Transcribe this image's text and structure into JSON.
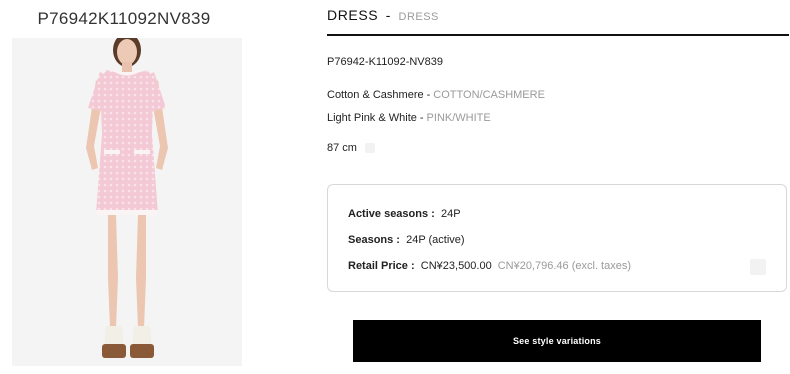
{
  "product": {
    "sku_heading": "P76942K11092NV839",
    "title": "DRESS",
    "title_sep": "-",
    "title_en": "DRESS",
    "reference": "P76942-K11092-NV839",
    "material": "Cotton & Cashmere",
    "material_en": "COTTON/CASHMERE",
    "color": "Light Pink & White",
    "color_en": "PINK/WHITE",
    "length": "87 cm"
  },
  "info": {
    "active_seasons_label": "Active seasons :",
    "active_seasons_value": "24P",
    "seasons_label": "Seasons :",
    "seasons_value": "24P (active)",
    "retail_price_label": "Retail Price :",
    "retail_price_value": "CN¥23,500.00",
    "retail_price_excl": "CN¥20,796.46 (excl. taxes)"
  },
  "actions": {
    "style_variations_label": "See style variations"
  },
  "colors": {
    "dress_pink": "#f3c9d5",
    "trim_white": "#fbf4f4",
    "button_bg": "#000000"
  }
}
